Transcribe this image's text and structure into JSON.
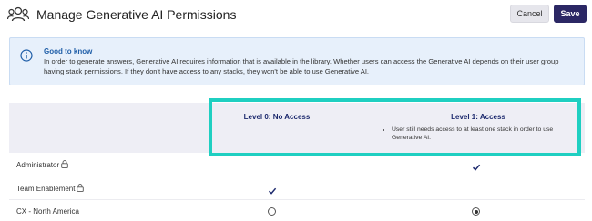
{
  "header": {
    "title": "Manage Generative AI Permissions",
    "cancel_label": "Cancel",
    "save_label": "Save"
  },
  "info": {
    "title": "Good to know",
    "body": "In order to generate answers, Generative AI requires information that is available in the library. Whether users can access the Generative AI depends on their user group having stack permissions. If they don't have access to any stacks, they won't be able to use Generative AI."
  },
  "columns": [
    {
      "label": "Level 0: No Access"
    },
    {
      "label": "Level 1: Access",
      "note": "User still needs access to at least one stack in order to use Generative AI."
    }
  ],
  "rows": [
    {
      "name": "Administrator",
      "locked": true,
      "level0": "",
      "level1": "check"
    },
    {
      "name": "Team Enablement",
      "locked": true,
      "level0": "check",
      "level1": ""
    },
    {
      "name": "CX - North America",
      "locked": false,
      "level0": "radio-empty",
      "level1": "radio-selected"
    }
  ],
  "colors": {
    "primary": "#2b2764",
    "highlight": "#1fcfc1",
    "info_bg": "#e7f0fb",
    "info_title": "#1f5ea8"
  }
}
